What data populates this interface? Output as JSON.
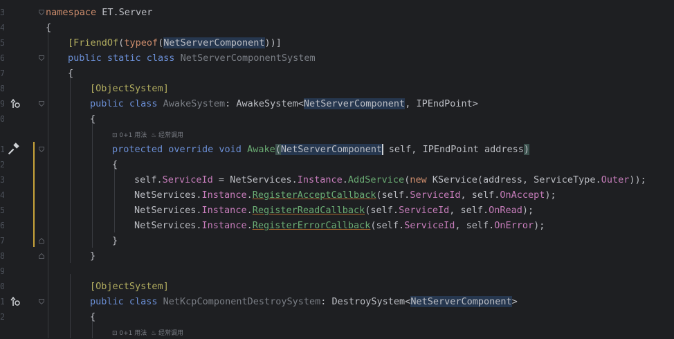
{
  "line_numbers": [
    "3",
    "4",
    "5",
    "6",
    "7",
    "8",
    "9",
    "0",
    "",
    "1",
    "2",
    "3",
    "4",
    "5",
    "6",
    "7",
    "8",
    "9",
    "0",
    "1",
    "2",
    ""
  ],
  "hints": {
    "awake": {
      "usages": "0+1 用法",
      "frequent": "经常调用"
    },
    "destroy": {
      "usages": "0+1 用法",
      "frequent": "经常调用"
    }
  },
  "code": {
    "l1": {
      "kw": "namespace",
      "name": " ET.Server"
    },
    "l2": {
      "text": "{"
    },
    "l3": {
      "open": "[",
      "friend": "FriendOf",
      "p1": "(",
      "typeof": "typeof",
      "p2": "(",
      "arg": "NetServerComponent",
      "close": "))]"
    },
    "l4": {
      "mods": "public static class ",
      "name": "NetServerComponentSystem"
    },
    "l5": {
      "text": "{"
    },
    "l6": {
      "open": "[",
      "name": "ObjectSystem",
      "close": "]"
    },
    "l7": {
      "mods": "public class ",
      "name": "AwakeSystem",
      "colon": ": ",
      "base": "AwakeSystem",
      "lt": "<",
      "g1": "NetServerComponent",
      "comma": ", ",
      "g2": "IPEndPoint",
      "gt": ">"
    },
    "l8": {
      "text": "{"
    },
    "l9": {
      "mods": "protected override void ",
      "method": "Awake",
      "po": "(",
      "ptype": "NetServerComponent",
      "p1": " self, ",
      "ptype2": "IPEndPoint",
      "p2": " address",
      "pc": ")"
    },
    "l10": {
      "text": "{"
    },
    "l11": {
      "self": "self.",
      "prop": "ServiceId",
      "eq": " = ",
      "cls": "NetServices",
      "dot1": ".",
      "inst": "Instance",
      "dot2": ".",
      "fn": "AddService",
      "po": "(",
      "new": "new ",
      "ks": "KService",
      "args": "(address, ",
      "st": "ServiceType",
      "dot3": ".",
      "outer": "Outer",
      "end": "));"
    },
    "l12": {
      "cls": "NetServices",
      "dot1": ".",
      "inst": "Instance",
      "dot2": ".",
      "fn": "RegisterAcceptCallback",
      "a1": "(self.",
      "prop": "ServiceId",
      "a2": ", self.",
      "cb": "OnAccept",
      "end": ");"
    },
    "l13": {
      "cls": "NetServices",
      "dot1": ".",
      "inst": "Instance",
      "dot2": ".",
      "fn": "RegisterReadCallback",
      "a1": "(self.",
      "prop": "ServiceId",
      "a2": ", self.",
      "cb": "OnRead",
      "end": ");"
    },
    "l14": {
      "cls": "NetServices",
      "dot1": ".",
      "inst": "Instance",
      "dot2": ".",
      "fn": "RegisterErrorCallback",
      "a1": "(self.",
      "prop": "ServiceId",
      "a2": ", self.",
      "cb": "OnError",
      "end": ");"
    },
    "l15": {
      "text": "}"
    },
    "l16": {
      "text": "}"
    },
    "l17": {
      "open": "[",
      "name": "ObjectSystem",
      "close": "]"
    },
    "l18": {
      "mods": "public class ",
      "name": "NetKcpComponentDestroySystem",
      "colon": ": ",
      "base": "DestroySystem",
      "lt": "<",
      "g1": "NetServerComponent",
      "gt": ">"
    },
    "l19": {
      "text": "{"
    }
  },
  "colors": {
    "background": "#1e1f22",
    "keyword": "#cf8e6d",
    "type": "#56a8f5",
    "attribute": "#b3ae60",
    "property": "#c77dbb",
    "change_marker": "#c9a43a"
  },
  "icons": [
    "implemented-icon",
    "override-hammer-icon",
    "fold-icon"
  ]
}
